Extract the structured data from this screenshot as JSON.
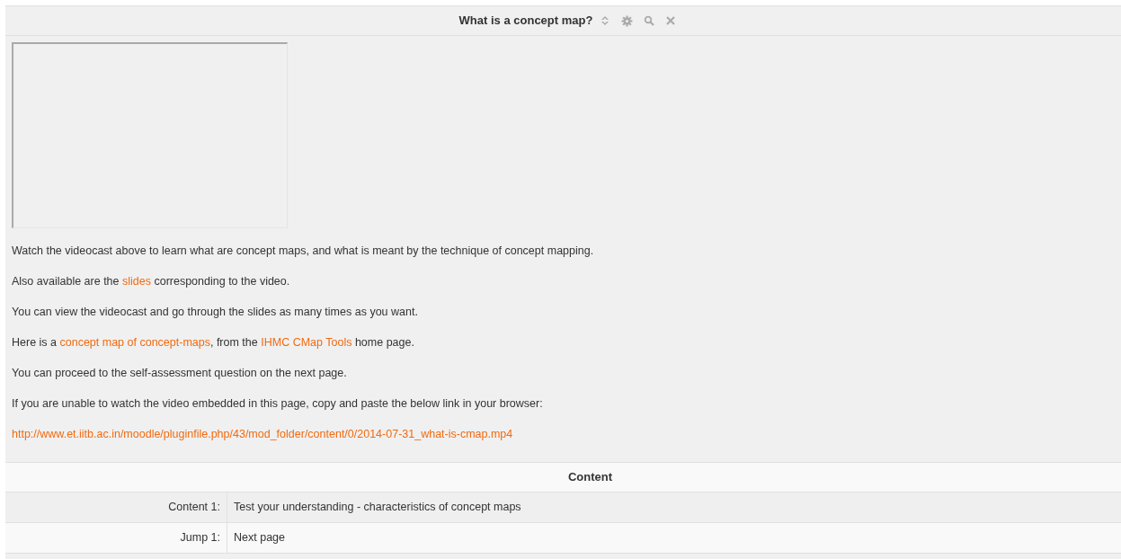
{
  "header": {
    "title": "What is a concept map?"
  },
  "paragraphs": [
    [
      {
        "text": "Watch the videocast above to learn what are concept maps, and what is meant by the technique of concept mapping.",
        "link": false
      }
    ],
    [
      {
        "text": "Also available are the ",
        "link": false
      },
      {
        "text": "slides",
        "link": true
      },
      {
        "text": " corresponding to the video.",
        "link": false
      }
    ],
    [
      {
        "text": "You can view the videocast and go through the slides as many times as you want.",
        "link": false
      }
    ],
    [
      {
        "text": "Here is a ",
        "link": false
      },
      {
        "text": "concept map of concept-maps",
        "link": true
      },
      {
        "text": ", from the ",
        "link": false
      },
      {
        "text": "IHMC CMap Tools",
        "link": true
      },
      {
        "text": " home page.",
        "link": false
      }
    ],
    [
      {
        "text": "You can proceed to the self-assessment question on the next page.",
        "link": false
      }
    ],
    [
      {
        "text": "If you are unable to watch the video embedded in this page, copy and paste the below link in your browser:",
        "link": false
      }
    ],
    [
      {
        "text": "http://www.et.iitb.ac.in/moodle/pluginfile.php/43/mod_folder/content/0/2014-07-31_what-is-cmap.mp4",
        "link": true
      }
    ]
  ],
  "table": {
    "heading": "Content",
    "rows": [
      {
        "label": "Content 1:",
        "value": "Test your understanding - characteristics of concept maps"
      },
      {
        "label": "Jump 1:",
        "value": "Next page"
      }
    ]
  }
}
